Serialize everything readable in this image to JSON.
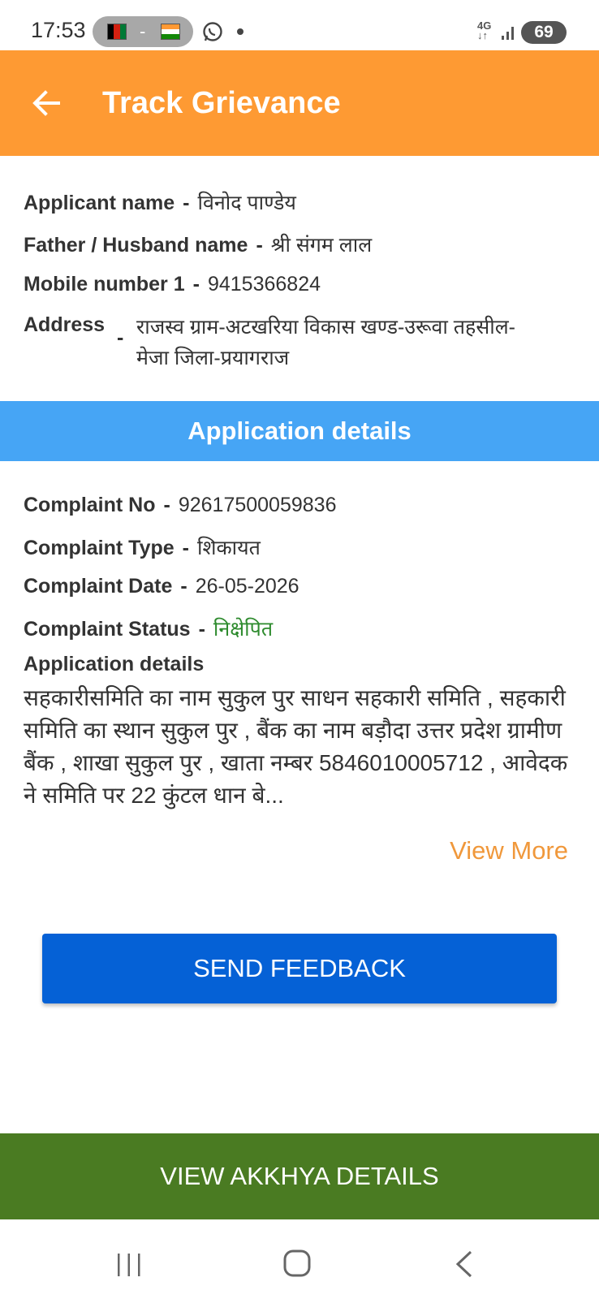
{
  "status_bar": {
    "time": "17:53",
    "network": "4G",
    "battery": "69",
    "icons": [
      "afghanistan-flag-icon",
      "india-flag-icon",
      "whatsapp-icon",
      "signal-icon",
      "battery-icon"
    ]
  },
  "app_bar": {
    "title": "Track Grievance",
    "back_icon": "arrow-left-icon"
  },
  "applicant": {
    "name_label": "Applicant name",
    "name_value": "विनोद पाण्डेय",
    "father_label": "Father / Husband name",
    "father_value": "श्री संगम लाल",
    "mobile_label": "Mobile number 1",
    "mobile_value": "9415366824",
    "address_label": "Address",
    "address_value": "राजस्व ग्राम-अटखरिया विकास खण्ड-उरूवा तहसील-मेजा जिला-प्रयागराज",
    "separator": "-"
  },
  "section": {
    "title": "Application details"
  },
  "complaint": {
    "no_label": "Complaint No",
    "no_value": "92617500059836",
    "type_label": "Complaint Type",
    "type_value": "शिकायत",
    "date_label": "Complaint Date",
    "date_value": "26-05-2026",
    "status_label": "Complaint Status",
    "status_value": "निक्षेपित",
    "status_color": "#2e8b2e",
    "details_label": "Application details",
    "details_text": "सहकारीसमिति का नाम सुकुल पुर साधन सहकारी समिति , सहकारी समिति का स्थान सुकुल पुर , बैंक का नाम  बड़ौदा उत्तर प्रदेश ग्रामीण बैंक , शाखा सुकुल पुर , खाता नम्बर 5846010005712 , आवेदक ने समिति पर 22 कुंटल धान बे..."
  },
  "actions": {
    "view_more": "View More",
    "send_feedback": "SEND FEEDBACK",
    "view_akkhya": "VIEW AKKHYA DETAILS"
  },
  "colors": {
    "app_bar": "#fe9a33",
    "section_header": "#46a5f5",
    "send_button": "#0561d6",
    "akkhya_button": "#4a7b22",
    "view_more": "#f0983b"
  }
}
